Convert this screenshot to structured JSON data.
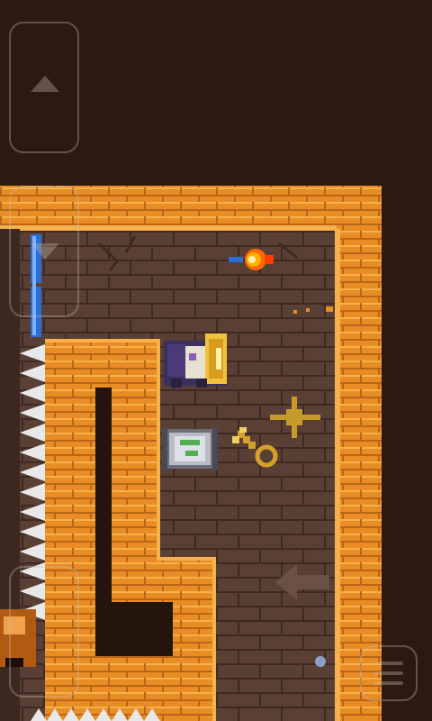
{
  "game": {
    "scene": "dungeon-room",
    "palette": {
      "background": "#2c1a10",
      "floor": "#5a3f35",
      "brick": "#e88c24",
      "brick_light": "#f6b04c",
      "spikes": "#e8e8e8",
      "bars": "#2a6fd6",
      "key": "#d4a22c",
      "fire": "#ffb000"
    },
    "controls": {
      "up": "arrow-up-icon",
      "down": "arrow-down-icon",
      "left": "arrow-left-icon",
      "menu": "menu-icon"
    },
    "entities": [
      "player-knight",
      "fireball",
      "key",
      "switch-canister",
      "spike-trap",
      "barred-gate",
      "spark-marker",
      "arrow-hint"
    ]
  }
}
